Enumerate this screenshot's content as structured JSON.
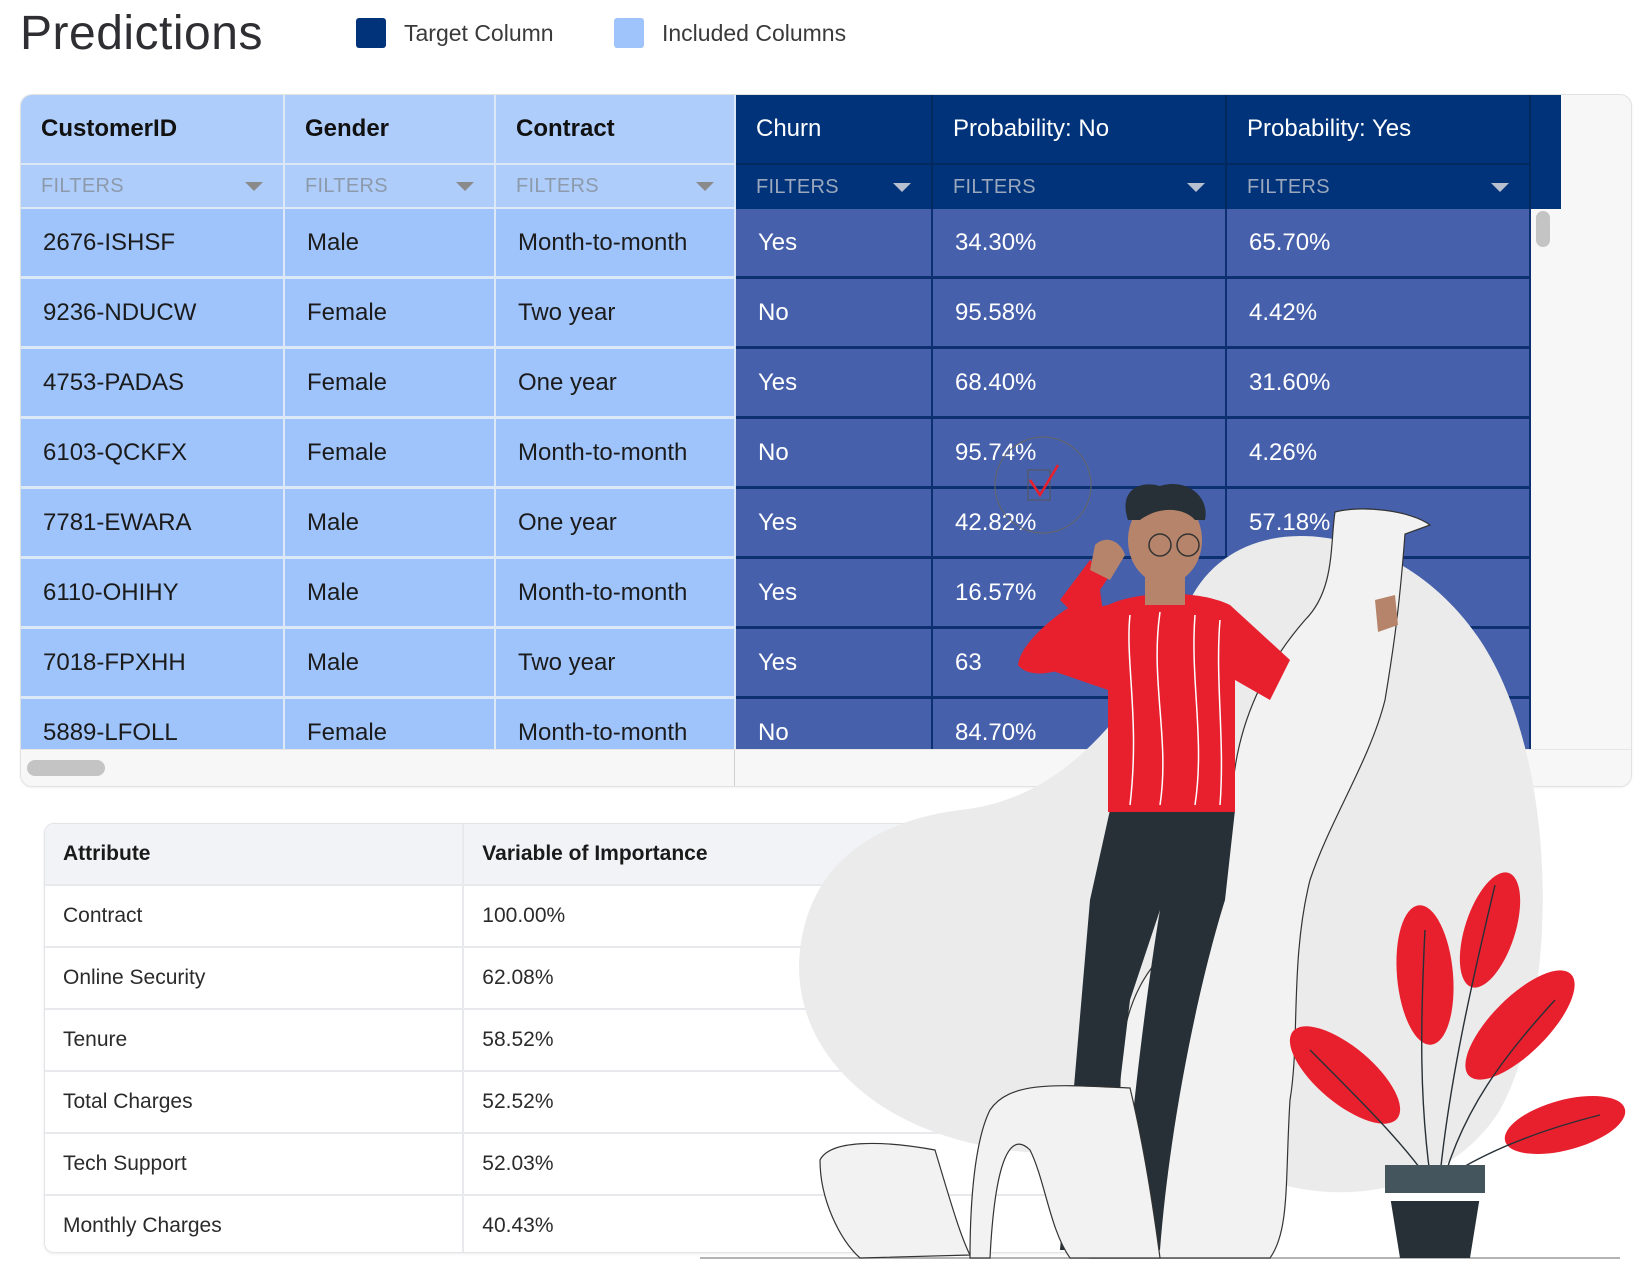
{
  "page": {
    "title": "Predictions",
    "legend": [
      {
        "label": "Target Column",
        "color": "#00337a"
      },
      {
        "label": "Included Columns",
        "color": "#9fc3fb"
      }
    ]
  },
  "predictions": {
    "columns": [
      {
        "label": "CustomerID",
        "type": "included",
        "filter_placeholder": "FILTERS"
      },
      {
        "label": "Gender",
        "type": "included",
        "filter_placeholder": "FILTERS"
      },
      {
        "label": "Contract",
        "type": "included",
        "filter_placeholder": "FILTERS"
      },
      {
        "label": "Churn",
        "type": "target",
        "filter_placeholder": "FILTERS"
      },
      {
        "label": "Probability: No",
        "type": "target",
        "filter_placeholder": "FILTERS"
      },
      {
        "label": "Probability: Yes",
        "type": "target",
        "filter_placeholder": "FILTERS"
      }
    ],
    "rows": [
      [
        "2676-ISHSF",
        "Male",
        "Month-to-month",
        "Yes",
        "34.30%",
        "65.70%"
      ],
      [
        "9236-NDUCW",
        "Female",
        "Two year",
        "No",
        "95.58%",
        "4.42%"
      ],
      [
        "4753-PADAS",
        "Female",
        "One year",
        "Yes",
        "68.40%",
        "31.60%"
      ],
      [
        "6103-QCKFX",
        "Female",
        "Month-to-month",
        "No",
        "95.74%",
        "4.26%"
      ],
      [
        "7781-EWARA",
        "Male",
        "One year",
        "Yes",
        "42.82%",
        "57.18%"
      ],
      [
        "6110-OHIHY",
        "Male",
        "Month-to-month",
        "Yes",
        "16.57%",
        ""
      ],
      [
        "7018-FPXHH",
        "Male",
        "Two year",
        "Yes",
        "63",
        ""
      ],
      [
        "5889-LFOLL",
        "Female",
        "Month-to-month",
        "No",
        "84.70%",
        ""
      ]
    ]
  },
  "importance": {
    "headers": [
      "Attribute",
      "Variable of Importance"
    ],
    "rows": [
      [
        "Contract",
        "100.00%"
      ],
      [
        "Online Security",
        "62.08%"
      ],
      [
        "Tenure",
        "58.52%"
      ],
      [
        "Total Charges",
        "52.52%"
      ],
      [
        "Tech Support",
        "52.03%"
      ],
      [
        "Monthly Charges",
        "40.43%"
      ]
    ]
  },
  "illustration": {
    "accent": "#e8202e",
    "shirt": "#e8202e",
    "pants": "#263036",
    "skin": "#b5846a",
    "blob": "#ebebeb"
  }
}
